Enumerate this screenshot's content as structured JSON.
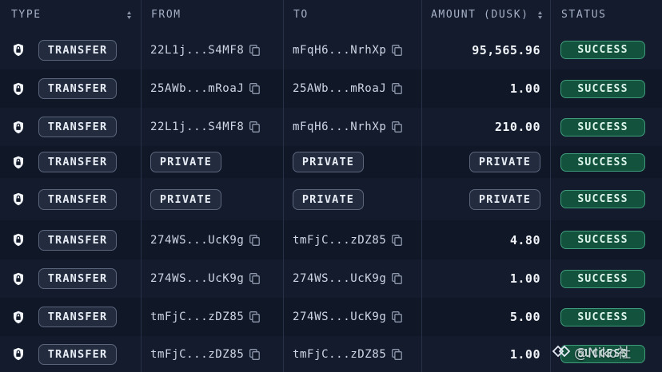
{
  "columns": {
    "type": "TYPE",
    "from": "FROM",
    "to": "TO",
    "amount": "AMOUNT (DUSK)",
    "status": "STATUS"
  },
  "rows": [
    {
      "type": "TRANSFER",
      "from": "22L1j...S4MF8",
      "to": "mFqH6...NrhXp",
      "amount": "95,565.96",
      "status": "SUCCESS"
    },
    {
      "type": "TRANSFER",
      "from": "25AWb...mRoaJ",
      "to": "25AWb...mRoaJ",
      "amount": "1.00",
      "status": "SUCCESS"
    },
    {
      "type": "TRANSFER",
      "from": "22L1j...S4MF8",
      "to": "mFqH6...NrhXp",
      "amount": "210.00",
      "status": "SUCCESS"
    },
    {
      "type": "TRANSFER",
      "from": "PRIVATE",
      "to": "PRIVATE",
      "amount": "PRIVATE",
      "status": "SUCCESS"
    },
    {
      "type": "TRANSFER",
      "from": "PRIVATE",
      "to": "PRIVATE",
      "amount": "PRIVATE",
      "status": "SUCCESS"
    },
    {
      "type": "TRANSFER",
      "from": "274WS...UcK9g",
      "to": "tmFjC...zDZ85",
      "amount": "4.80",
      "status": "SUCCESS"
    },
    {
      "type": "TRANSFER",
      "from": "274WS...UcK9g",
      "to": "274WS...UcK9g",
      "amount": "1.00",
      "status": "SUCCESS"
    },
    {
      "type": "TRANSFER",
      "from": "tmFjC...zDZ85",
      "to": "274WS...UcK9g",
      "amount": "5.00",
      "status": "SUCCESS"
    },
    {
      "type": "TRANSFER",
      "from": "tmFjC...zDZ85",
      "to": "tmFjC...zDZ85",
      "amount": "1.00",
      "status": "SUCCESS"
    }
  ],
  "watermark": "@Niko社",
  "icons": {
    "type_icon": "shield-lock-icon",
    "copy_icon": "copy-icon",
    "sort_icon": "sort-icon",
    "watermark_logo": "niko-logo-icon"
  },
  "colors": {
    "background": "#101727",
    "status_bg": "#13533e",
    "status_border": "#3f9c7b",
    "pill_bg": "#232c3e"
  }
}
